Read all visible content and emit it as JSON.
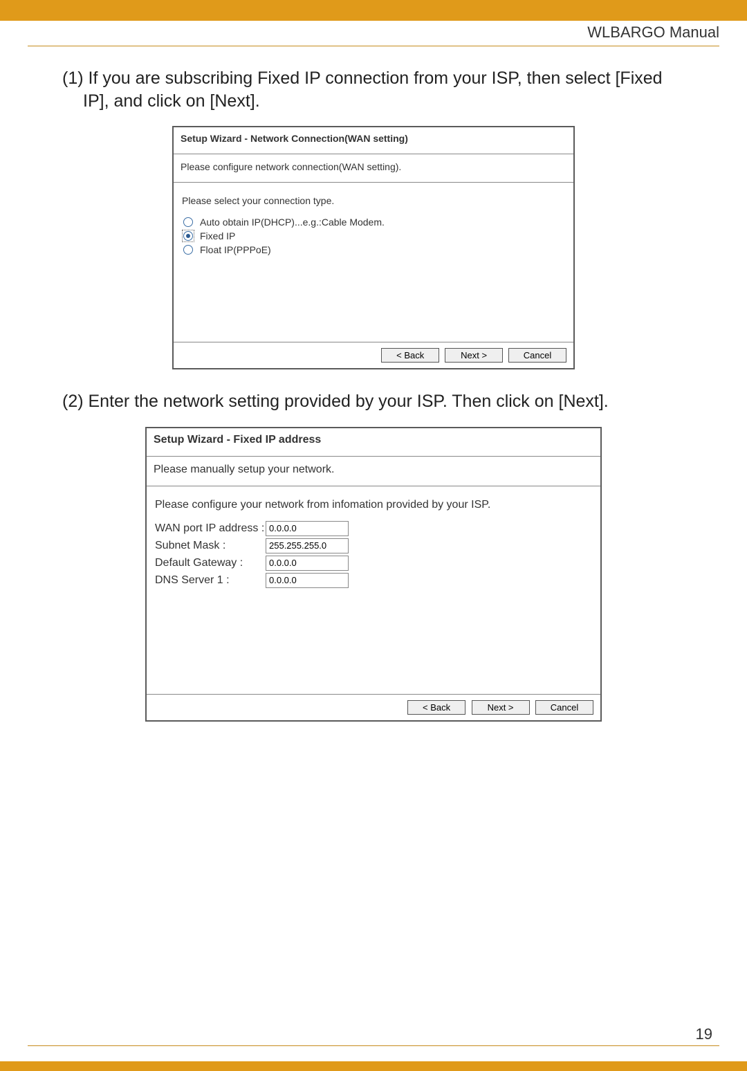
{
  "header": {
    "manual_title": "WLBARGO Manual"
  },
  "instructions": {
    "step1": "(1) If you are subscribing Fixed IP connection from your ISP, then select [Fixed IP], and click on [Next].",
    "step2": "(2) Enter the network setting provided by your ISP. Then click on [Next]."
  },
  "wizard1": {
    "title": "Setup Wizard - Network Connection(WAN setting)",
    "subtitle": "Please configure network connection(WAN setting).",
    "prompt": "Please select your connection type.",
    "options": {
      "opt1": "Auto obtain IP(DHCP)...e.g.:Cable Modem.",
      "opt2": "Fixed IP",
      "opt3": "Float IP(PPPoE)"
    },
    "buttons": {
      "back": "< Back",
      "next": "Next >",
      "cancel": "Cancel"
    }
  },
  "wizard2": {
    "title": "Setup Wizard - Fixed IP address",
    "subtitle": "Please manually setup your network.",
    "prompt": "Please configure your network from infomation provided by your ISP.",
    "fields": {
      "wan_ip": {
        "label": "WAN port IP address :",
        "value": "0.0.0.0"
      },
      "subnet": {
        "label": "Subnet Mask :",
        "value": "255.255.255.0"
      },
      "gateway": {
        "label": "Default Gateway :",
        "value": "0.0.0.0"
      },
      "dns1": {
        "label": "DNS Server 1 :",
        "value": "0.0.0.0"
      }
    },
    "buttons": {
      "back": "< Back",
      "next": "Next >",
      "cancel": "Cancel"
    }
  },
  "page_number": "19"
}
